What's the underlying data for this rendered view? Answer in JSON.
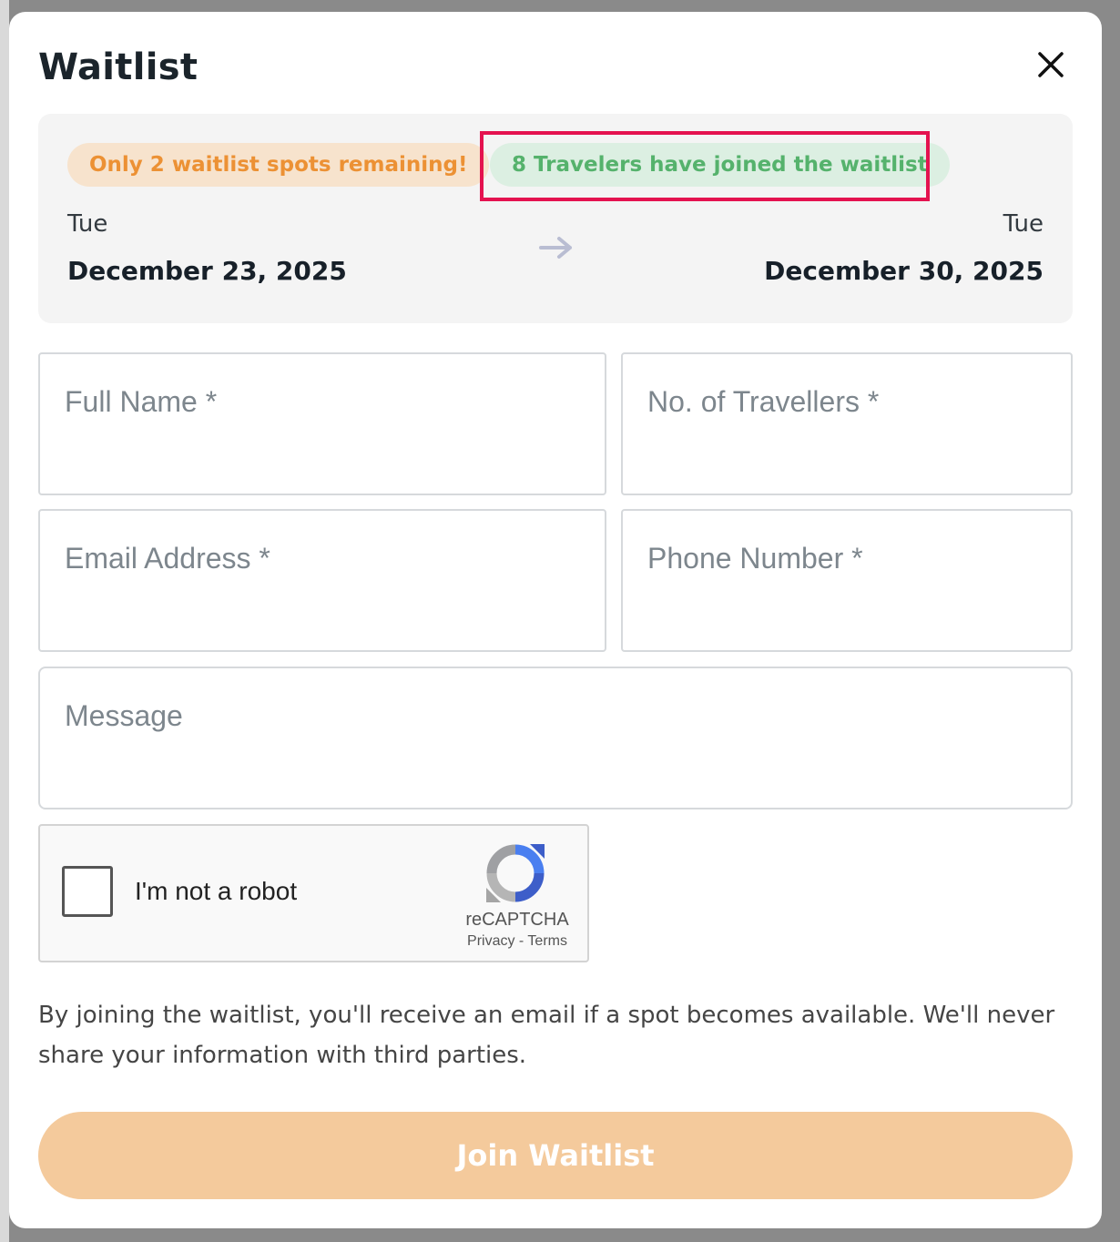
{
  "modal": {
    "title": "Waitlist",
    "close_icon": "close-icon"
  },
  "summary": {
    "spots_badge": "Only 2 waitlist spots remaining!",
    "joined_badge": "8 Travelers have joined the waitlist",
    "start_day": "Tue",
    "start_date": "December 23, 2025",
    "end_day": "Tue",
    "end_date": "December 30, 2025",
    "arrow_icon": "arrow-right-icon"
  },
  "form": {
    "full_name_placeholder": "Full Name *",
    "travellers_placeholder": "No. of Travellers *",
    "email_placeholder": "Email Address *",
    "phone_placeholder": "Phone Number *",
    "message_placeholder": "Message"
  },
  "recaptcha": {
    "label": "I'm not a robot",
    "brand": "reCAPTCHA",
    "links": "Privacy - Terms",
    "logo_icon": "recaptcha-logo-icon"
  },
  "notice": "By joining the waitlist, you'll receive an email if a spot becomes available. We'll never share your information with third parties.",
  "submit_label": "Join Waitlist",
  "colors": {
    "accent_orange": "#ec9134",
    "accent_green": "#55b26c",
    "highlight": "#e4124f",
    "button_bg": "#f4ca9c"
  }
}
